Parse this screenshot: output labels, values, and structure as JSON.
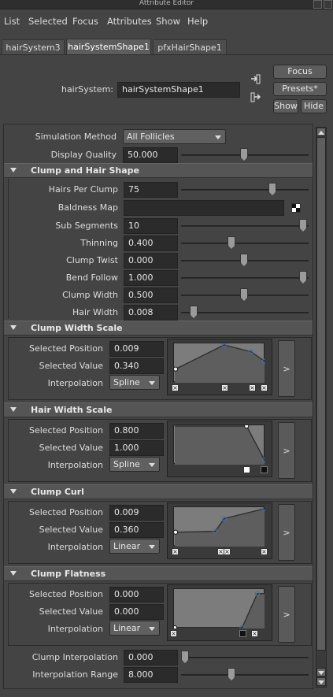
{
  "window": {
    "title": "Attribute Editor"
  },
  "menu": [
    "List",
    "Selected",
    "Focus",
    "Attributes",
    "Show",
    "Help"
  ],
  "tabs": [
    {
      "label": "hairSystem3",
      "active": false
    },
    {
      "label": "hairSystemShape1",
      "active": true
    },
    {
      "label": "pfxHairShape1",
      "active": false
    }
  ],
  "node": {
    "label": "hairSystem:",
    "value": "hairSystemShape1"
  },
  "buttons": {
    "focus": "Focus",
    "presets": "Presets*",
    "show": "Show",
    "hide": "Hide"
  },
  "top_attrs": {
    "simulation_method": {
      "label": "Simulation Method",
      "value": "All Follicles"
    },
    "display_quality": {
      "label": "Display Quality",
      "value": "50.000",
      "slider": 0.5
    }
  },
  "clump_hair_shape": {
    "title": "Clump and Hair Shape",
    "attrs": [
      {
        "label": "Hairs Per Clump",
        "value": "75",
        "slider": 0.75
      },
      {
        "label": "Baldness Map",
        "value": ""
      },
      {
        "label": "Sub Segments",
        "value": "10",
        "slider": 1.0
      },
      {
        "label": "Thinning",
        "value": "0.400",
        "slider": 0.4
      },
      {
        "label": "Clump Twist",
        "value": "0.000",
        "slider": 0.5
      },
      {
        "label": "Bend Follow",
        "value": "1.000",
        "slider": 1.0
      },
      {
        "label": "Clump Width",
        "value": "0.500",
        "slider": 0.5
      },
      {
        "label": "Hair Width",
        "value": "0.008",
        "slider": 0.1
      }
    ]
  },
  "ramp_labels": {
    "position": "Selected Position",
    "value": "Selected Value",
    "interp": "Interpolation",
    "expand": ">"
  },
  "ramps": [
    {
      "title": "Clump Width Scale",
      "position": "0.009",
      "value": "0.340",
      "interpolation": "Spline",
      "points": [
        [
          0.009,
          0.34
        ],
        [
          0.55,
          0.98
        ],
        [
          0.85,
          0.8
        ],
        [
          1.0,
          0.55
        ]
      ]
    },
    {
      "title": "Hair Width Scale",
      "position": "0.800",
      "value": "1.000",
      "interpolation": "Spline",
      "points": [
        [
          0.8,
          1.0
        ],
        [
          1.0,
          0.1
        ]
      ]
    },
    {
      "title": "Clump Curl",
      "position": "0.009",
      "value": "0.360",
      "interpolation": "Linear",
      "points": [
        [
          0.009,
          0.36
        ],
        [
          0.45,
          0.38
        ],
        [
          0.55,
          0.72
        ],
        [
          1.0,
          0.98
        ]
      ]
    },
    {
      "title": "Clump Flatness",
      "position": "0.000",
      "value": "0.000",
      "interpolation": "Linear",
      "points": [
        [
          0.0,
          0.0
        ],
        [
          0.75,
          0.0
        ],
        [
          0.92,
          0.9
        ]
      ]
    }
  ],
  "bottom_attrs": [
    {
      "label": "Clump Interpolation",
      "value": "0.000",
      "slider": 0.0
    },
    {
      "label": "Interpolation Range",
      "value": "8.000",
      "slider": 0.4
    }
  ]
}
